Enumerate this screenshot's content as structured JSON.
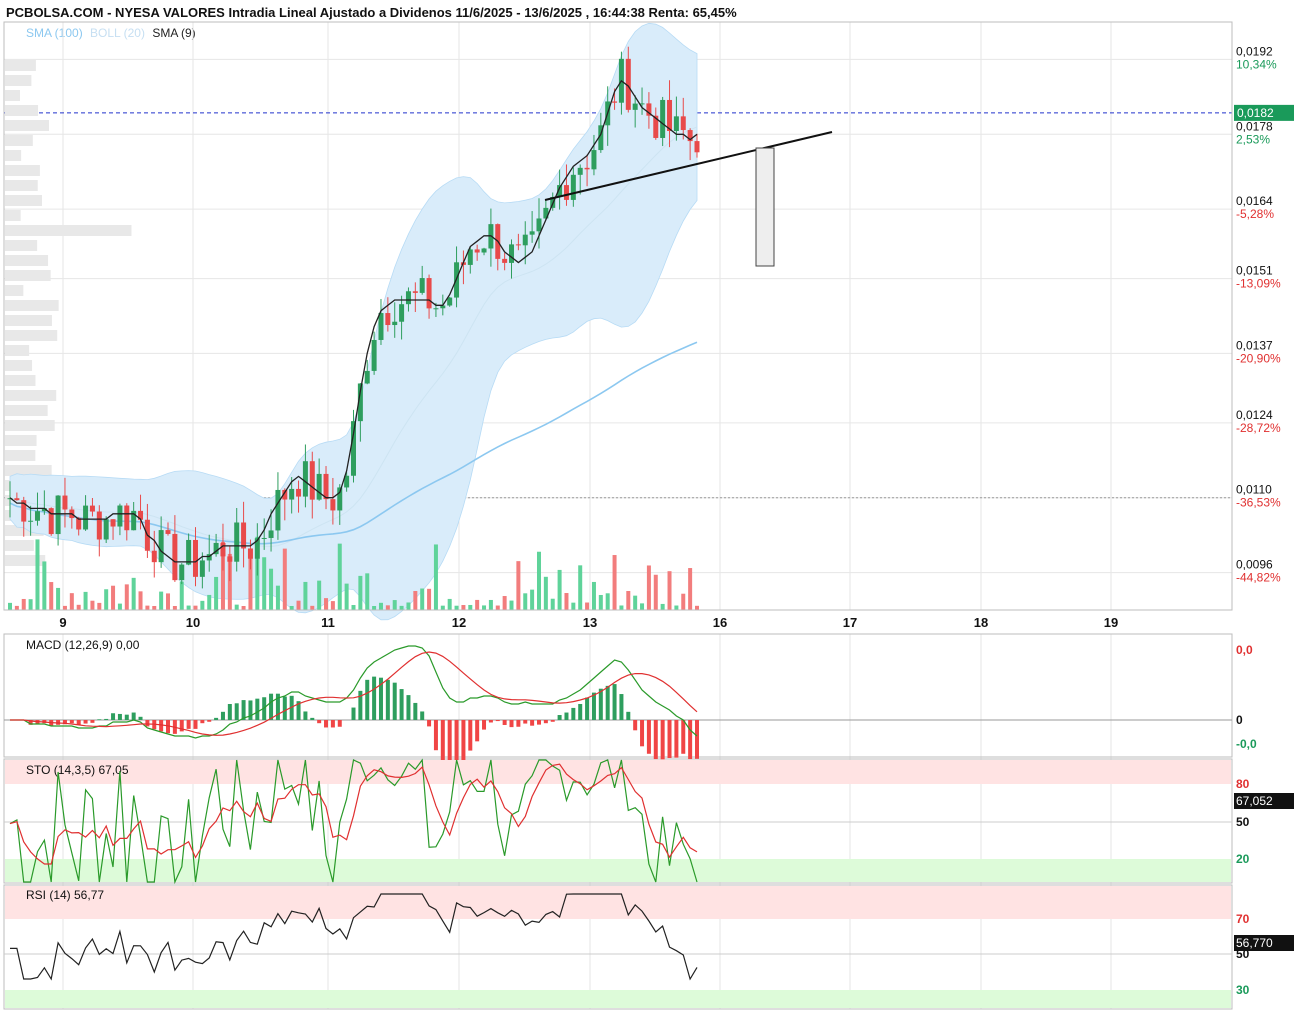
{
  "header": {
    "title": "PCBOLSA.COM - NYESA VALORES Intradia Lineal Ajustado a Dividenos 11/6/2025 - 13/6/2025 , 16:44:38 Renta: 65,45%"
  },
  "legend": {
    "sma100": {
      "label": "SMA (100)",
      "color": "#8cc8f0"
    },
    "boll": {
      "label": "BOLL (20)",
      "color": "#c6dff2"
    },
    "sma9": {
      "label": "SMA (9)",
      "color": "#222222"
    }
  },
  "colors": {
    "up": "#2e9e5e",
    "down": "#e84a4a",
    "vol_up": "#5fd39a",
    "vol_down": "#f27d7d",
    "band": "#d9ecfa",
    "grid": "#e6e6e6"
  },
  "chart_data": [
    {
      "type": "candlestick",
      "name": "price",
      "y_labels": [
        {
          "price": "0,0192",
          "pct": "10,34%",
          "pct_color": "#1a9a5a"
        },
        {
          "price": "0,0178",
          "pct": "2,53%",
          "pct_color": "#1a9a5a"
        },
        {
          "price": "0,0164",
          "pct": "-5,28%",
          "pct_color": "#e03030"
        },
        {
          "price": "0,0151",
          "pct": "-13,09%",
          "pct_color": "#e03030"
        },
        {
          "price": "0,0137",
          "pct": "-20,90%",
          "pct_color": "#e03030"
        },
        {
          "price": "0,0124",
          "pct": "-28,72%",
          "pct_color": "#e03030"
        },
        {
          "price": "0,0110",
          "pct": "-36,53%",
          "pct_color": "#e03030"
        },
        {
          "price": "0,0096",
          "pct": "-44,82%",
          "pct_color": "#e03030"
        }
      ],
      "last_price": "0,0182",
      "ref_price": 0.011,
      "ylim": [
        0.0089,
        0.0199
      ],
      "x_ticks": [
        "9",
        "10",
        "11",
        "12",
        "13",
        "16",
        "17",
        "18",
        "19"
      ],
      "sma9_closes": [
        0.011,
        0.0109,
        0.0109,
        0.0108,
        0.0108,
        0.0108,
        0.0107,
        0.0107,
        0.0107,
        0.0107,
        0.0106,
        0.0106,
        0.0106,
        0.0106,
        0.0106,
        0.0107,
        0.0107,
        0.0107,
        0.0107,
        0.0106,
        0.0103,
        0.0102,
        0.01,
        0.0099,
        0.0098,
        0.0098,
        0.0098,
        0.0098,
        0.0099,
        0.0099,
        0.01,
        0.0101,
        0.0101,
        0.0101,
        0.0101,
        0.0101,
        0.0102,
        0.0104,
        0.0107,
        0.0109,
        0.0111,
        0.0113,
        0.0114,
        0.0113,
        0.0112,
        0.0111,
        0.011,
        0.011,
        0.0111,
        0.0115,
        0.0122,
        0.013,
        0.0137,
        0.0142,
        0.0145,
        0.0146,
        0.0147,
        0.0147,
        0.0147,
        0.0147,
        0.0147,
        0.0147,
        0.0146,
        0.0146,
        0.0148,
        0.0151,
        0.0154,
        0.0157,
        0.0158,
        0.0159,
        0.0159,
        0.0158,
        0.0156,
        0.0155,
        0.0154,
        0.0155,
        0.0156,
        0.0159,
        0.0162,
        0.0165,
        0.0168,
        0.017,
        0.0172,
        0.0173,
        0.0174,
        0.0176,
        0.0178,
        0.0182,
        0.0186,
        0.0188,
        0.0187,
        0.0185,
        0.0183,
        0.0182,
        0.0181,
        0.018,
        0.0179,
        0.0178,
        0.0178,
        0.0177,
        0.0178
      ]
    },
    {
      "type": "line",
      "name": "MACD (12,26,9)",
      "label": "MACD (12,26,9)",
      "value": "0,00",
      "axis_labels": [
        {
          "text": "0,0",
          "color": "#e03030"
        },
        {
          "text": "0",
          "color": "#111111"
        },
        {
          "text": "-0,0",
          "color": "#1a9a5a"
        }
      ]
    },
    {
      "type": "line",
      "name": "STO (14,3,5)",
      "label": "STO (14,3,5)",
      "value": "67,05",
      "last_badge": "67,052",
      "levels": [
        {
          "text": "80",
          "color": "#e03030"
        },
        {
          "text": "50",
          "color": "#111111"
        },
        {
          "text": "20",
          "color": "#1a9a5a"
        }
      ]
    },
    {
      "type": "line",
      "name": "RSI (14)",
      "label": "RSI (14)",
      "value": "56,77",
      "last_badge": "56,770",
      "levels": [
        {
          "text": "70",
          "color": "#e03030"
        },
        {
          "text": "50",
          "color": "#111111"
        },
        {
          "text": "30",
          "color": "#1a9a5a"
        }
      ]
    }
  ]
}
